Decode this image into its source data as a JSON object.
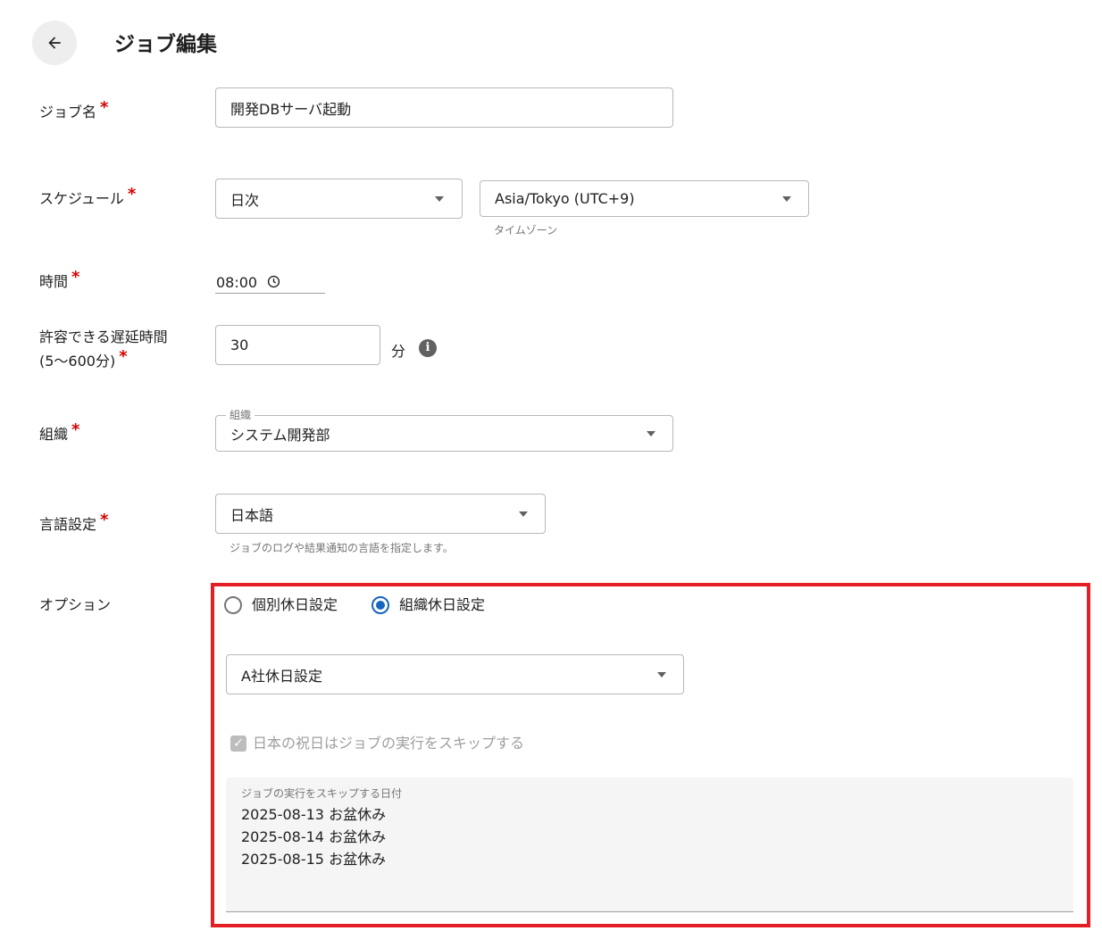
{
  "header": {
    "title": "ジョブ編集",
    "back_icon": "arrow-left-icon"
  },
  "required_mark": "*",
  "job_name": {
    "label": "ジョブ名",
    "value": "開発DBサーバ起動"
  },
  "schedule": {
    "label": "スケジュール",
    "frequency": "日次",
    "timezone": "Asia/Tokyo (UTC+9)",
    "timezone_helper": "タイムゾーン"
  },
  "time": {
    "label": "時間",
    "value": "08:00",
    "icon": "clock-icon"
  },
  "delay": {
    "label_line1": "許容できる遅延時間",
    "label_line2": "(5〜600分)",
    "value": "30",
    "unit": "分",
    "info_icon": "i"
  },
  "organization": {
    "label": "組織",
    "legend": "組織",
    "value": "システム開発部"
  },
  "language": {
    "label": "言語設定",
    "value": "日本語",
    "helper": "ジョブのログや結果通知の言語を指定します。"
  },
  "options": {
    "label": "オプション",
    "radio_individual": "個別休日設定",
    "radio_organization": "組織休日設定",
    "selected": "組織休日設定",
    "holiday_setting": "A社休日設定",
    "skip_holidays_label": "日本の祝日はジョブの実行をスキップする",
    "skip_holidays_checked": true,
    "skip_dates_label": "ジョブの実行をスキップする日付",
    "skip_dates": [
      "2025-08-13 お盆休み",
      "2025-08-14 お盆休み",
      "2025-08-15 お盆休み"
    ]
  },
  "colors": {
    "required": "#d50000",
    "radio_selected": "#1565c0",
    "highlight_border": "#e31e24"
  }
}
